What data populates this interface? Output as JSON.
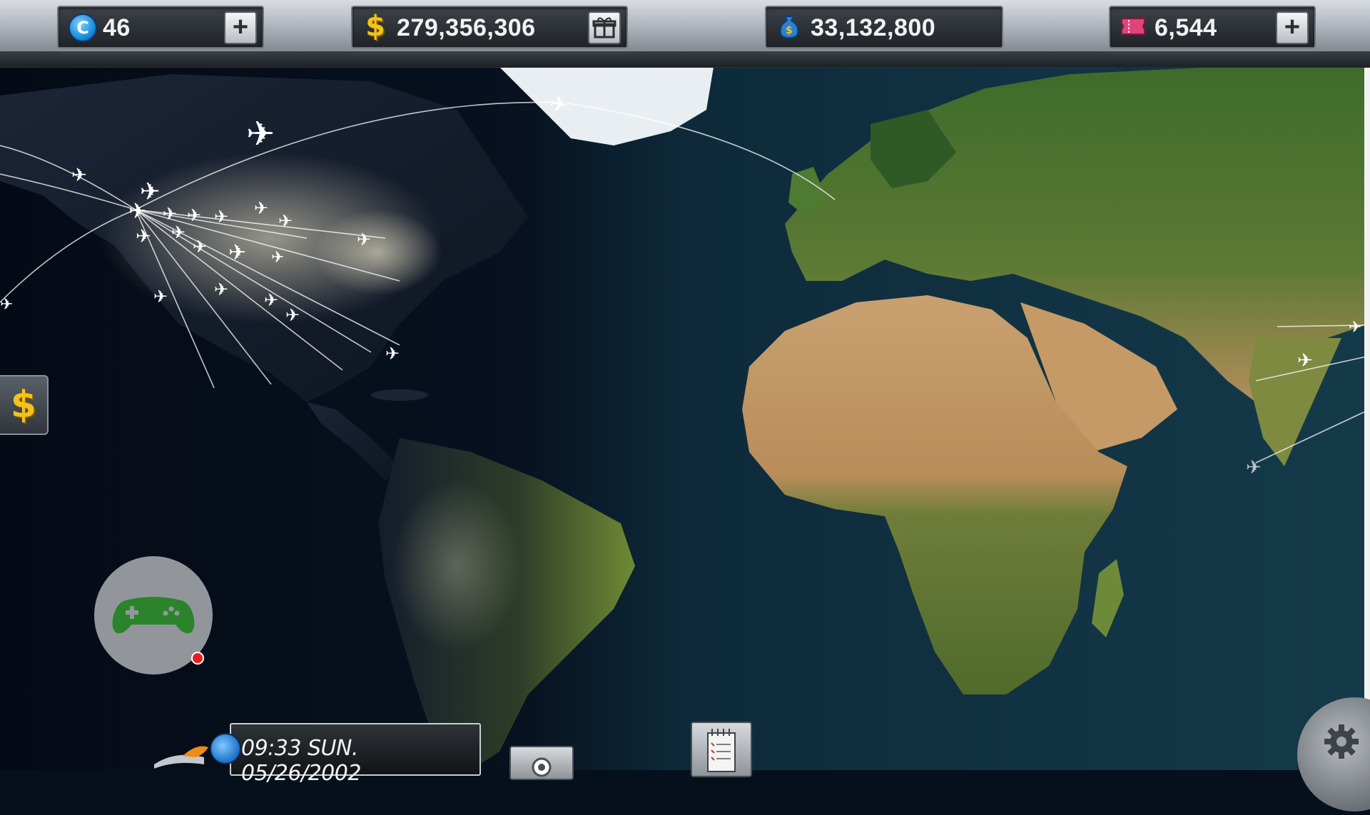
{
  "resources": {
    "coins": {
      "icon": "coin-c-icon",
      "icon_letter": "C",
      "value": "46"
    },
    "cash": {
      "icon": "dollar-icon",
      "icon_symbol": "$",
      "value": "279,356,306"
    },
    "fuel_money": {
      "icon": "money-bag-icon",
      "value": "33,132,800"
    },
    "tickets": {
      "icon": "ticket-icon",
      "value": "6,544"
    }
  },
  "buttons": {
    "plus": "+",
    "money_side": "$"
  },
  "status": {
    "datetime": "09:33 SUN. 05/26/2002"
  },
  "colors": {
    "topbar": "#b4bac2",
    "accent_gold": "#f4c318",
    "coin_blue": "#1a8fe0",
    "gamepad_green": "#2e8b2e",
    "notification_red": "#e81d1d"
  }
}
